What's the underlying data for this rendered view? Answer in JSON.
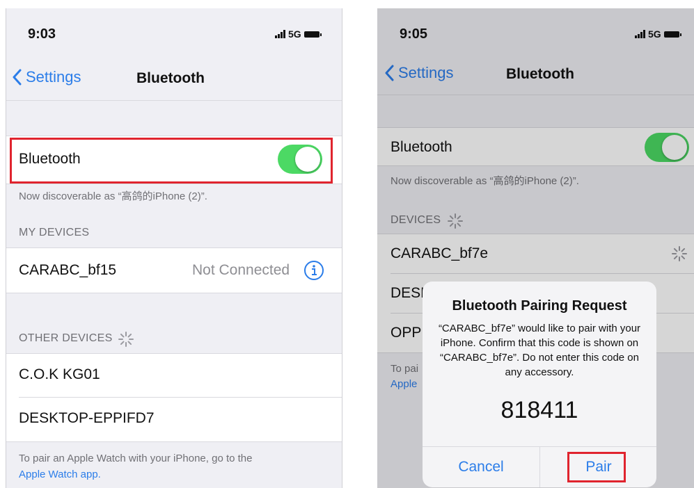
{
  "left": {
    "status": {
      "time": "9:03",
      "network": "5G"
    },
    "nav": {
      "back_label": "Settings",
      "title": "Bluetooth"
    },
    "bluetooth_label": "Bluetooth",
    "bluetooth_on": true,
    "discoverable_text": "Now discoverable as “高鸽的iPhone (2)”.",
    "my_devices_header": "MY DEVICES",
    "my_devices": [
      {
        "name": "CARABC_bf15",
        "status": "Not Connected"
      }
    ],
    "other_devices_header": "OTHER DEVICES",
    "other_devices": [
      {
        "name": "C.O.K KG01"
      },
      {
        "name": "DESKTOP-EPPIFD7"
      }
    ],
    "footer_text": "To pair an Apple Watch with your iPhone, go to the",
    "footer_link": "Apple Watch app."
  },
  "right": {
    "status": {
      "time": "9:05",
      "network": "5G"
    },
    "nav": {
      "back_label": "Settings",
      "title": "Bluetooth"
    },
    "bluetooth_label": "Bluetooth",
    "bluetooth_on": true,
    "discoverable_text": "Now discoverable as “高鸽的iPhone (2)”.",
    "devices_header": "DEVICES",
    "devices": [
      {
        "name": "CARABC_bf7e"
      },
      {
        "name": "DESK"
      },
      {
        "name": "OPP"
      }
    ],
    "footer_text": "To pai",
    "footer_link": "Apple",
    "alert": {
      "title": "Bluetooth Pairing Request",
      "message": "“CARABC_bf7e” would like to pair with your iPhone. Confirm that this code is shown on “CARABC_bf7e”. Do not enter this code on any accessory.",
      "code": "818411",
      "cancel_label": "Cancel",
      "pair_label": "Pair"
    }
  },
  "colors": {
    "accent": "#2b7de9",
    "toggle_on": "#4cd964",
    "highlight": "#e0242e",
    "background": "#efeff4"
  },
  "icons": [
    "chevron-left-icon",
    "info-icon",
    "spinner-icon",
    "signal-bars-icon",
    "battery-icon"
  ]
}
